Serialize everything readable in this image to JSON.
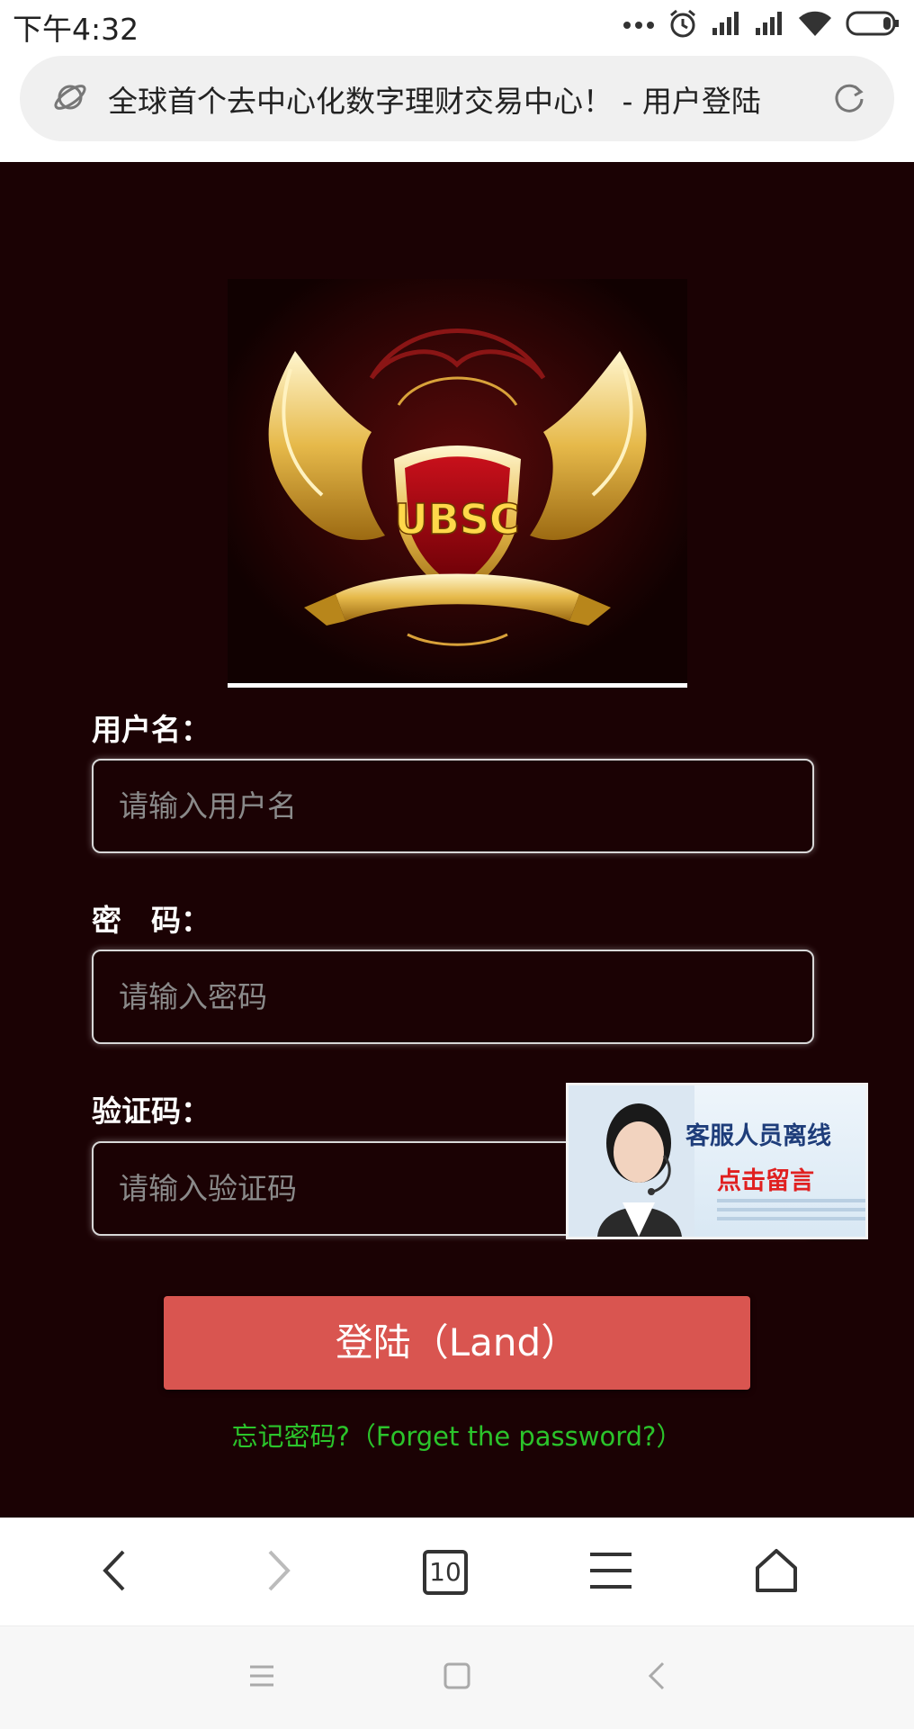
{
  "status_bar": {
    "time": "下午4:32",
    "icons": [
      "more-dots-icon",
      "alarm-icon",
      "signal-icon",
      "signal-icon",
      "wifi-icon",
      "battery-icon"
    ]
  },
  "url_bar": {
    "title": "全球首个去中心化数字理财交易中心！ - 用户登陆",
    "left_icon": "planet-icon",
    "right_icon": "refresh-icon"
  },
  "logo": {
    "text": "UBSC"
  },
  "form": {
    "username_label": "用户名：",
    "username_placeholder": "请输入用户名",
    "password_label": "密　码：",
    "password_placeholder": "请输入密码",
    "captcha_label": "验证码：",
    "captcha_placeholder": "请输入验证码",
    "login_button": "登陆（Land）",
    "forgot_link": "忘记密码?（Forget the password?）"
  },
  "service_banner": {
    "line1": "客服人员离线",
    "line2": "点击留言"
  },
  "browser_bar": {
    "tab_count": "10",
    "icons": [
      "back-icon",
      "forward-icon",
      "tabs-icon",
      "menu-icon",
      "home-icon"
    ]
  },
  "nav_bar": {
    "icons": [
      "recents-icon",
      "home-nav-icon",
      "back-nav-icon"
    ]
  },
  "colors": {
    "page_background": "#1b0204",
    "login_button": "#d95550",
    "forgot_link": "#2bc42b"
  }
}
